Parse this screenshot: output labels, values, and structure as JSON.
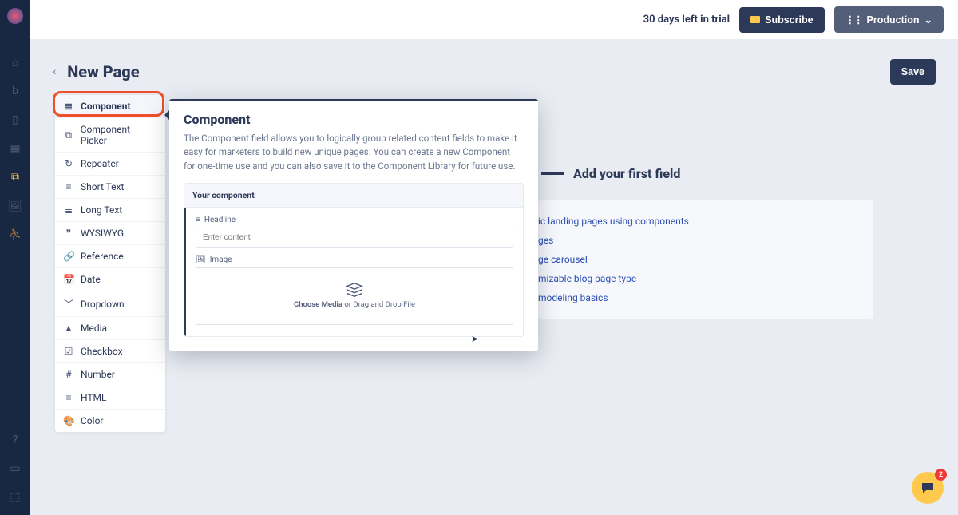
{
  "topbar": {
    "trial_text": "30 days left in trial",
    "subscribe_label": "Subscribe",
    "production_label": "Production"
  },
  "header": {
    "page_title": "New Page",
    "save_label": "Save"
  },
  "field_types": {
    "items": [
      {
        "icon": "≣",
        "label": "Component"
      },
      {
        "icon": "⧉",
        "label": "Component Picker"
      },
      {
        "icon": "↻",
        "label": "Repeater"
      },
      {
        "icon": "≡",
        "label": "Short Text"
      },
      {
        "icon": "≣",
        "label": "Long Text"
      },
      {
        "icon": "❞",
        "label": "WYSIWYG"
      },
      {
        "icon": "🔗",
        "label": "Reference"
      },
      {
        "icon": "📅",
        "label": "Date"
      },
      {
        "icon": "﹀",
        "label": "Dropdown"
      },
      {
        "icon": "▲",
        "label": "Media"
      },
      {
        "icon": "☑",
        "label": "Checkbox"
      },
      {
        "icon": "#",
        "label": "Number"
      },
      {
        "icon": "≡",
        "label": "HTML"
      },
      {
        "icon": "🎨",
        "label": "Color"
      }
    ]
  },
  "popover": {
    "title": "Component",
    "desc": "The Component field allows you to logically group related content fields to make it easy for marketers to build new unique pages. You can create a new Component for one-time use and you can also save it to the Component Library for future use.",
    "preview_title": "Your component",
    "headline_label": "Headline",
    "headline_placeholder": "Enter content",
    "image_label": "Image",
    "media_text_strong": "Choose Media",
    "media_text_rest": " or Drag and Drop File"
  },
  "content": {
    "heading": "Add your first field",
    "links": [
      "ic landing pages using components",
      "ges",
      "ge carousel",
      "mizable blog page type",
      "modeling basics"
    ]
  },
  "chat": {
    "badge": "2"
  }
}
